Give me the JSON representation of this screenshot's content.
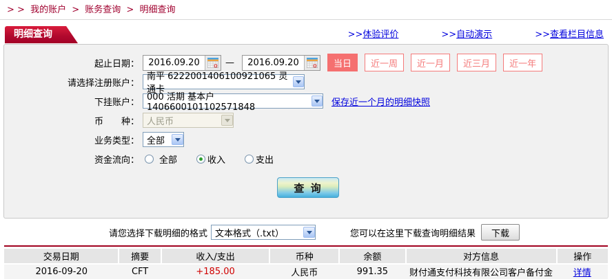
{
  "colors": {
    "dark_red": "#a0002e",
    "tab_red": "#b20a2e",
    "salmon": "#f57070",
    "link_blue": "#0000dd",
    "amount_red": "#d00000",
    "panel_gray": "#f1f1f1"
  },
  "breadcrumb": {
    "prefix": "> >",
    "sep": ">",
    "items": [
      "我的账户",
      "账务查询",
      "明细查询"
    ]
  },
  "tab": {
    "label": "明细查询"
  },
  "header_links": [
    {
      "prefix": ">>",
      "label": "体验评价"
    },
    {
      "prefix": ">>",
      "label": "自动演示"
    },
    {
      "prefix": ">>",
      "label": "查看栏目信息"
    }
  ],
  "form": {
    "date_label": "起止日期：",
    "date_from": "2016.09.20",
    "date_to": "2016.09.20",
    "date_separator": "—",
    "quick_buttons": [
      {
        "label": "当日",
        "active": true
      },
      {
        "label": "近一周",
        "active": false
      },
      {
        "label": "近一月",
        "active": false
      },
      {
        "label": "近三月",
        "active": false
      },
      {
        "label": "近一年",
        "active": false
      }
    ],
    "register_account": {
      "label": "请选择注册账户：",
      "value": "南平  6222001406100921065  灵通卡"
    },
    "sub_account": {
      "label": "下挂账户：",
      "value": "000  活期  基本户  1406600101102571848",
      "snapshot_link": "保存近一个月的明细快照"
    },
    "currency": {
      "label": "币　　种：",
      "value": "人民币",
      "disabled": true
    },
    "biz_type": {
      "label": "业务类型：",
      "value": "全部"
    },
    "flow": {
      "label": "资金流向：",
      "options": [
        {
          "label": "全部",
          "checked": false
        },
        {
          "label": "收入",
          "checked": true
        },
        {
          "label": "支出",
          "checked": false
        }
      ]
    },
    "query_button": "查 询"
  },
  "download": {
    "format_label": "请您选择下载明细的格式",
    "format_value": "文本格式（.txt）",
    "hint": "您可以在这里下载查询明细结果",
    "button": "下载"
  },
  "table": {
    "headers": [
      "交易日期",
      "摘要",
      "收入/支出",
      "币种",
      "余额",
      "对方信息",
      "操作"
    ],
    "rows": [
      [
        "2016-09-20",
        "CFT",
        "+185.00",
        "人民币",
        "991.35",
        "财付通支付科技有限公司客户备付金",
        "详情"
      ]
    ]
  }
}
